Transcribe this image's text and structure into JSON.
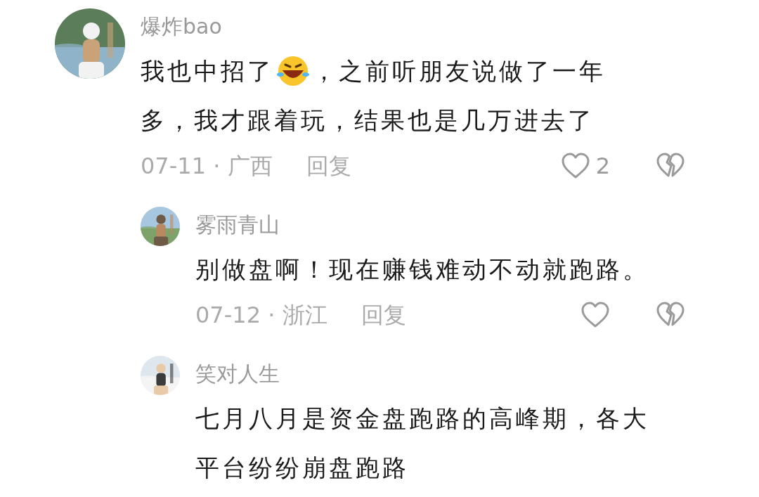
{
  "comments": [
    {
      "kind": "comment",
      "user": "爆炸bao",
      "lines": [
        [
          {
            "kind": "text",
            "text": "我也中招了"
          },
          {
            "kind": "emoji"
          },
          {
            "kind": "text",
            "text": "，之前听朋友说做了一年"
          }
        ],
        [
          {
            "kind": "text",
            "text": "多，我才跟着玩，结果也是几万进去了"
          }
        ]
      ],
      "meta": "07-11 · 广西",
      "reply": "回复",
      "likes": "2"
    },
    {
      "kind": "reply",
      "user": "雾雨青山",
      "lines": [
        [
          {
            "kind": "text",
            "text": "别做盘啊！现在赚钱难动不动就跑路。"
          }
        ]
      ],
      "meta": "07-12 · 浙江",
      "reply": "回复"
    },
    {
      "kind": "reply",
      "user": "笑对人生",
      "lines": [
        [
          {
            "kind": "text",
            "text": "七月八月是资金盘跑路的高峰期，各大"
          }
        ],
        [
          {
            "kind": "text",
            "text": "平台纷纷崩盘跑路"
          }
        ]
      ]
    }
  ]
}
